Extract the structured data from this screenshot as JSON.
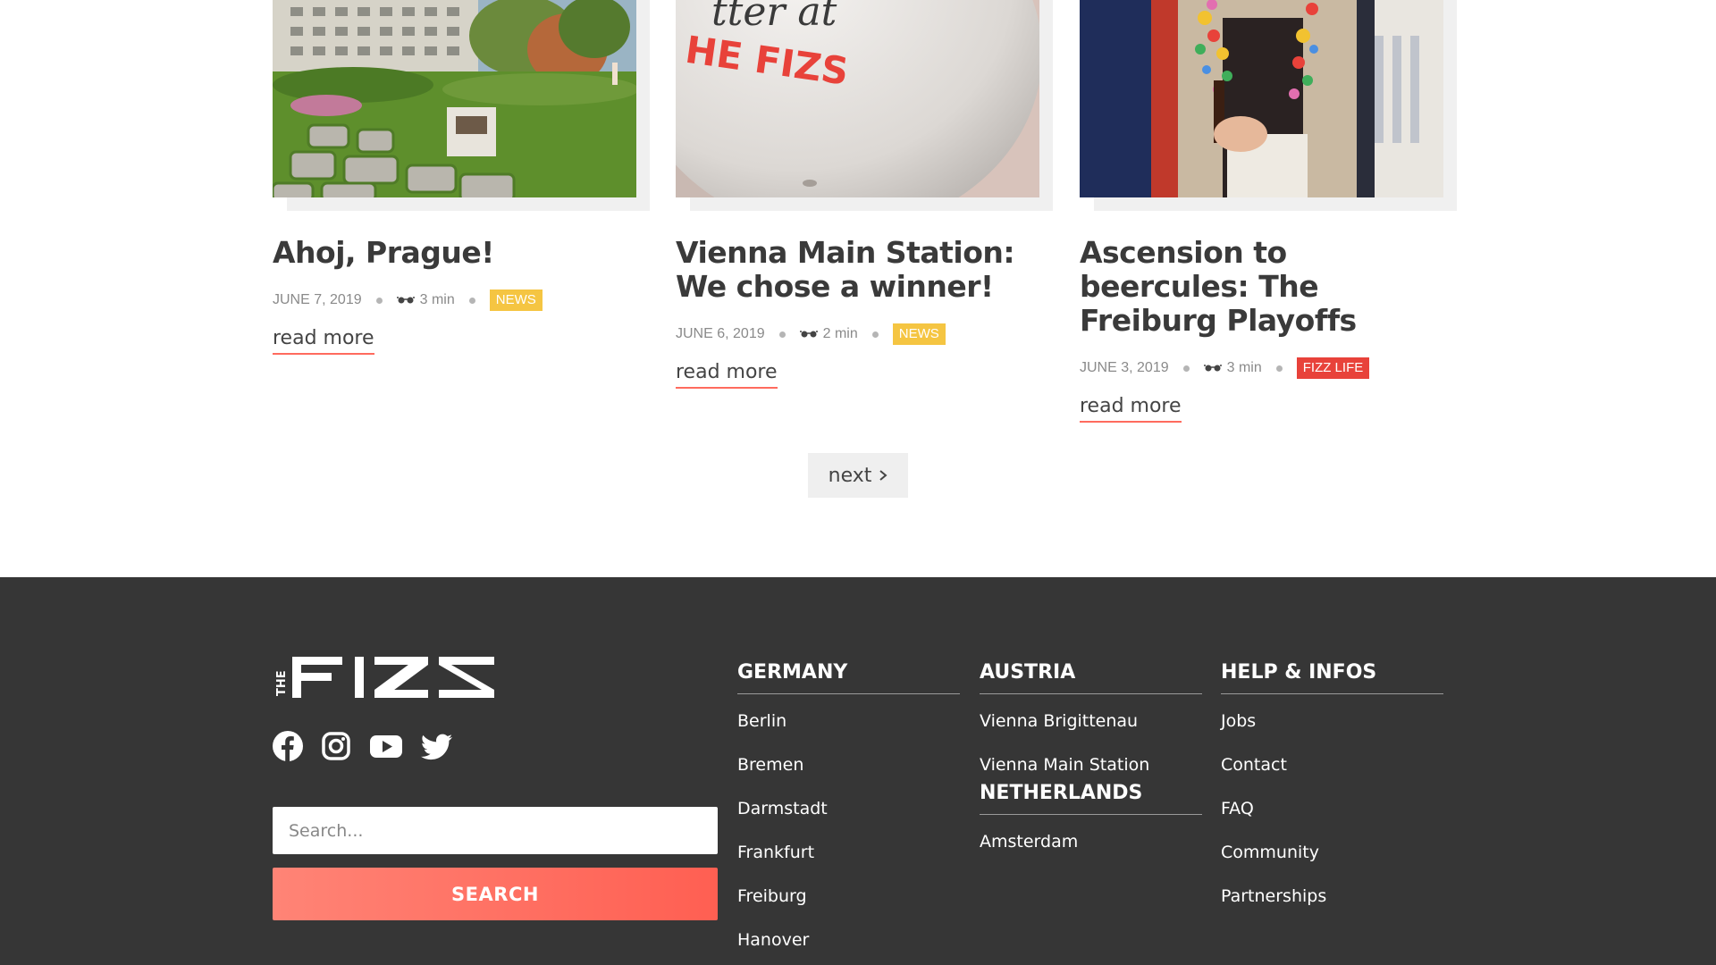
{
  "articles": [
    {
      "title": "Ahoj, Prague!",
      "date": "JUNE 7, 2019",
      "read_time": "3 min",
      "tag": "NEWS",
      "tag_color": "#f5c542",
      "read_more": "read more"
    },
    {
      "title": "Vienna Main Station: We chose a winner!",
      "date": "JUNE 6, 2019",
      "read_time": "2 min",
      "tag": "NEWS",
      "tag_color": "#f5c542",
      "read_more": "read more"
    },
    {
      "title": "Ascension to beercules: The Freiburg Playoffs",
      "date": "JUNE 3, 2019",
      "read_time": "3 min",
      "tag": "FIZZ LIFE",
      "tag_color": "#e8423a",
      "read_more": "read more"
    }
  ],
  "pagination": {
    "next_label": "next"
  },
  "footer": {
    "logo_side": "THE",
    "logo_main": "FIZZ",
    "search": {
      "placeholder": "Search...",
      "button_label": "SEARCH"
    },
    "columns": {
      "germany": {
        "heading": "GERMANY",
        "items": [
          "Berlin",
          "Bremen",
          "Darmstadt",
          "Frankfurt",
          "Freiburg",
          "Hanover"
        ]
      },
      "austria": {
        "heading": "AUSTRIA",
        "items": [
          "Vienna Brigittenau",
          "Vienna Main Station"
        ]
      },
      "netherlands": {
        "heading": "NETHERLANDS",
        "items": [
          "Amsterdam"
        ]
      },
      "help": {
        "heading": "HELP & INFOS",
        "items": [
          "Jobs",
          "Contact",
          "FAQ",
          "Community",
          "Partnerships"
        ]
      }
    },
    "social_icons": [
      "facebook-icon",
      "instagram-icon",
      "youtube-icon",
      "twitter-icon"
    ]
  },
  "colors": {
    "accent": "#ff6b5e",
    "footer_bg": "#363636",
    "news_tag": "#f5c542",
    "fizz_life_tag": "#e8423a"
  }
}
